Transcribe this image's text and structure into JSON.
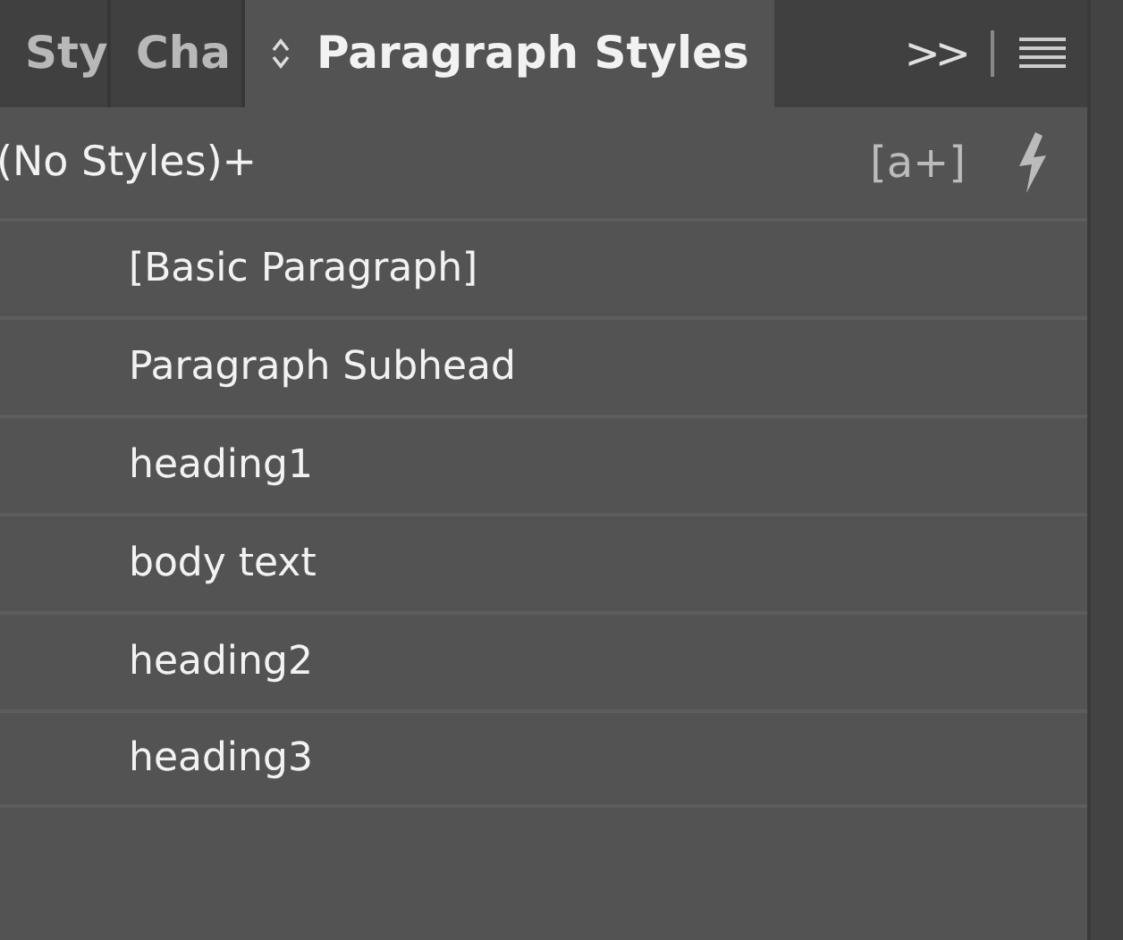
{
  "tabs": [
    {
      "label": "Sty",
      "selected": false
    },
    {
      "label": "Cha",
      "selected": false
    },
    {
      "label": "Paragraph Styles",
      "selected": true
    }
  ],
  "overflow_button": ">>",
  "style_set": {
    "label": "(No Styles)+",
    "new_group_button": "[a+]"
  },
  "styles": [
    {
      "name": "[Basic Paragraph]"
    },
    {
      "name": "Paragraph Subhead"
    },
    {
      "name": "heading1"
    },
    {
      "name": "body text"
    },
    {
      "name": "heading2"
    },
    {
      "name": "heading3"
    }
  ]
}
